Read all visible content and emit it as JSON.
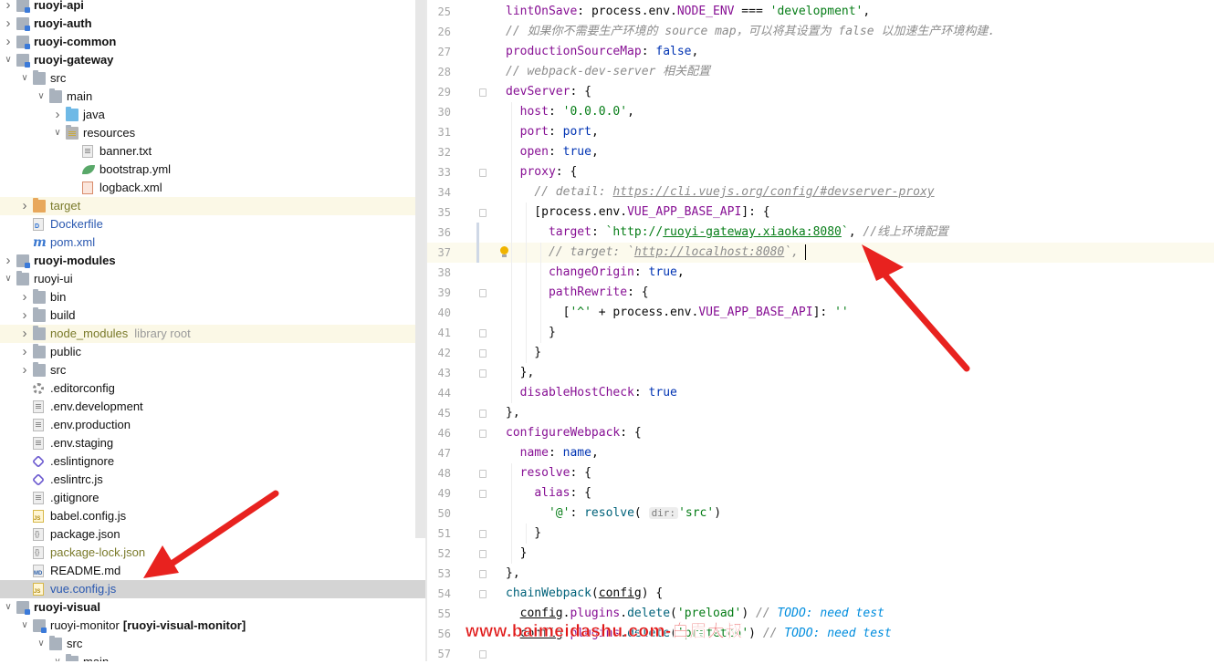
{
  "tree": [
    {
      "label": "ruoyi-api",
      "depth": 0,
      "icon": "module-folder-icon",
      "chev": "right",
      "bold": true
    },
    {
      "label": "ruoyi-auth",
      "depth": 0,
      "icon": "module-folder-icon",
      "chev": "right",
      "bold": true
    },
    {
      "label": "ruoyi-common",
      "depth": 0,
      "icon": "module-folder-icon",
      "chev": "right",
      "bold": true
    },
    {
      "label": "ruoyi-gateway",
      "depth": 0,
      "icon": "module-folder-icon",
      "chev": "down",
      "bold": true
    },
    {
      "label": "src",
      "depth": 1,
      "icon": "folder-icon",
      "chev": "down"
    },
    {
      "label": "main",
      "depth": 2,
      "icon": "folder-icon",
      "chev": "down"
    },
    {
      "label": "java",
      "depth": 3,
      "icon": "source-folder-icon",
      "chev": "right"
    },
    {
      "label": "resources",
      "depth": 3,
      "icon": "resources-folder-icon",
      "chev": "down"
    },
    {
      "label": "banner.txt",
      "depth": 4,
      "icon": "text-file-icon"
    },
    {
      "label": "bootstrap.yml",
      "depth": 4,
      "icon": "yaml-leaf-icon"
    },
    {
      "label": "logback.xml",
      "depth": 4,
      "icon": "xml-file-icon"
    },
    {
      "label": "target",
      "depth": 1,
      "icon": "excluded-folder-icon",
      "chev": "right",
      "style": "olive",
      "excluded": true
    },
    {
      "label": "Dockerfile",
      "depth": 1,
      "icon": "docker-file-icon",
      "style": "blue"
    },
    {
      "label": "pom.xml",
      "depth": 1,
      "icon": "maven-pom-icon",
      "style": "blue"
    },
    {
      "label": "ruoyi-modules",
      "depth": 0,
      "icon": "module-folder-icon",
      "chev": "right",
      "bold": true
    },
    {
      "label": "ruoyi-ui",
      "depth": 0,
      "icon": "folder-icon",
      "chev": "down"
    },
    {
      "label": "bin",
      "depth": 1,
      "icon": "folder-icon",
      "chev": "right"
    },
    {
      "label": "build",
      "depth": 1,
      "icon": "folder-icon",
      "chev": "right"
    },
    {
      "label": "node_modules",
      "depth": 1,
      "icon": "folder-icon",
      "chev": "right",
      "style": "olive",
      "hint": "library root",
      "excluded": true
    },
    {
      "label": "public",
      "depth": 1,
      "icon": "folder-icon",
      "chev": "right"
    },
    {
      "label": "src",
      "depth": 1,
      "icon": "folder-icon",
      "chev": "right"
    },
    {
      "label": ".editorconfig",
      "depth": 1,
      "icon": "gear-icon"
    },
    {
      "label": ".env.development",
      "depth": 1,
      "icon": "text-file-icon"
    },
    {
      "label": ".env.production",
      "depth": 1,
      "icon": "text-file-icon"
    },
    {
      "label": ".env.staging",
      "depth": 1,
      "icon": "text-file-icon"
    },
    {
      "label": ".eslintignore",
      "depth": 1,
      "icon": "eslint-icon"
    },
    {
      "label": ".eslintrc.js",
      "depth": 1,
      "icon": "eslint-icon"
    },
    {
      "label": ".gitignore",
      "depth": 1,
      "icon": "text-file-icon"
    },
    {
      "label": "babel.config.js",
      "depth": 1,
      "icon": "js-file-icon"
    },
    {
      "label": "package.json",
      "depth": 1,
      "icon": "json-file-icon"
    },
    {
      "label": "package-lock.json",
      "depth": 1,
      "icon": "json-file-icon",
      "style": "olive"
    },
    {
      "label": "README.md",
      "depth": 1,
      "icon": "markdown-file-icon"
    },
    {
      "label": "vue.config.js",
      "depth": 1,
      "icon": "js-file-icon",
      "style": "blue",
      "selected": true
    },
    {
      "label": "ruoyi-visual",
      "depth": 0,
      "icon": "module-folder-icon",
      "chev": "down",
      "bold": true
    },
    {
      "label": "ruoyi-monitor",
      "depth": 1,
      "icon": "module-folder-icon",
      "chev": "down",
      "hintBold": "[ruoyi-visual-monitor]"
    },
    {
      "label": "src",
      "depth": 2,
      "icon": "folder-icon",
      "chev": "down"
    },
    {
      "label": "main",
      "depth": 3,
      "icon": "folder-icon",
      "chev": "down"
    }
  ],
  "editor": {
    "first_line": 25,
    "current_line": 37,
    "lines": [
      [
        [
          "p",
          "lintOnSave"
        ],
        [
          "t",
          ": "
        ],
        [
          "t",
          "process.env."
        ],
        [
          "p",
          "NODE_ENV"
        ],
        [
          "t",
          " === "
        ],
        [
          "s",
          "'development'"
        ],
        [
          "t",
          ","
        ]
      ],
      [
        [
          "c",
          "// 如果你不需要生产环境的 source map，可以将其设置为 false 以加速生产环境构建."
        ]
      ],
      [
        [
          "p",
          "productionSourceMap"
        ],
        [
          "t",
          ": "
        ],
        [
          "b",
          "false"
        ],
        [
          "t",
          ","
        ]
      ],
      [
        [
          "c",
          "// webpack-dev-server 相关配置"
        ]
      ],
      [
        [
          "p",
          "devServer"
        ],
        [
          "t",
          ": {"
        ]
      ],
      [
        [
          "t",
          "  "
        ],
        [
          "p",
          "host"
        ],
        [
          "t",
          ": "
        ],
        [
          "s",
          "'0.0.0.0'"
        ],
        [
          "t",
          ","
        ]
      ],
      [
        [
          "t",
          "  "
        ],
        [
          "p",
          "port"
        ],
        [
          "t",
          ": "
        ],
        [
          "b",
          "port"
        ],
        [
          "t",
          ","
        ]
      ],
      [
        [
          "t",
          "  "
        ],
        [
          "p",
          "open"
        ],
        [
          "t",
          ": "
        ],
        [
          "b",
          "true"
        ],
        [
          "t",
          ","
        ]
      ],
      [
        [
          "t",
          "  "
        ],
        [
          "p",
          "proxy"
        ],
        [
          "t",
          ": {"
        ]
      ],
      [
        [
          "t",
          "    "
        ],
        [
          "c",
          "// detail: "
        ],
        [
          "u",
          "https://cli.vuejs.org/config/#devserver-proxy"
        ]
      ],
      [
        [
          "t",
          "    ["
        ],
        [
          "t",
          "process.env."
        ],
        [
          "p",
          "VUE_APP_BASE_API"
        ],
        [
          "t",
          "]: {"
        ]
      ],
      [
        [
          "t",
          "      "
        ],
        [
          "p",
          "target"
        ],
        [
          "t",
          ": "
        ],
        [
          "s",
          "`http://"
        ],
        [
          "us",
          "ruoyi-gateway.xiaoka:8080"
        ],
        [
          "s",
          "`"
        ],
        [
          "t",
          ", "
        ],
        [
          "c",
          "//线上环境配置"
        ]
      ],
      [
        [
          "t",
          "      "
        ],
        [
          "c",
          "// target: `"
        ],
        [
          "u",
          "http://localhost:8080"
        ],
        [
          "c",
          "`,"
        ]
      ],
      [
        [
          "t",
          "      "
        ],
        [
          "p",
          "changeOrigin"
        ],
        [
          "t",
          ": "
        ],
        [
          "b",
          "true"
        ],
        [
          "t",
          ","
        ]
      ],
      [
        [
          "t",
          "      "
        ],
        [
          "p",
          "pathRewrite"
        ],
        [
          "t",
          ": {"
        ]
      ],
      [
        [
          "t",
          "        ["
        ],
        [
          "s",
          "'^'"
        ],
        [
          "t",
          " + process.env."
        ],
        [
          "p",
          "VUE_APP_BASE_API"
        ],
        [
          "t",
          "]: "
        ],
        [
          "s",
          "''"
        ]
      ],
      [
        [
          "t",
          "      }"
        ]
      ],
      [
        [
          "t",
          "    }"
        ]
      ],
      [
        [
          "t",
          "  },"
        ]
      ],
      [
        [
          "t",
          "  "
        ],
        [
          "p",
          "disableHostCheck"
        ],
        [
          "t",
          ": "
        ],
        [
          "b",
          "true"
        ]
      ],
      [
        [
          "t",
          "},"
        ]
      ],
      [
        [
          "p",
          "configureWebpack"
        ],
        [
          "t",
          ": {"
        ]
      ],
      [
        [
          "t",
          "  "
        ],
        [
          "p",
          "name"
        ],
        [
          "t",
          ": "
        ],
        [
          "b",
          "name"
        ],
        [
          "t",
          ","
        ]
      ],
      [
        [
          "t",
          "  "
        ],
        [
          "p",
          "resolve"
        ],
        [
          "t",
          ": {"
        ]
      ],
      [
        [
          "t",
          "    "
        ],
        [
          "p",
          "alias"
        ],
        [
          "t",
          ": {"
        ]
      ],
      [
        [
          "t",
          "      "
        ],
        [
          "s",
          "'@'"
        ],
        [
          "t",
          ": "
        ],
        [
          "f",
          "resolve"
        ],
        [
          "t",
          "( "
        ],
        [
          "h",
          "dir:"
        ],
        [
          "s",
          "'src'"
        ],
        [
          "t",
          ")"
        ]
      ],
      [
        [
          "t",
          "    }"
        ]
      ],
      [
        [
          "t",
          "  }"
        ]
      ],
      [
        [
          "t",
          "},"
        ]
      ],
      [
        [
          "f",
          "chainWebpack"
        ],
        [
          "t",
          "("
        ],
        [
          "x",
          "config"
        ],
        [
          "t",
          ") {"
        ]
      ],
      [
        [
          "t",
          "  "
        ],
        [
          "x",
          "config"
        ],
        [
          "t",
          "."
        ],
        [
          "p",
          "plugins"
        ],
        [
          "t",
          "."
        ],
        [
          "f",
          "delete"
        ],
        [
          "t",
          "("
        ],
        [
          "s",
          "'preload'"
        ],
        [
          "t",
          ") "
        ],
        [
          "c",
          "// "
        ],
        [
          "todo",
          "TODO: need test"
        ]
      ],
      [
        [
          "t",
          "  "
        ],
        [
          "x",
          "config"
        ],
        [
          "t",
          "."
        ],
        [
          "p",
          "plugins"
        ],
        [
          "t",
          "."
        ],
        [
          "f",
          "delete"
        ],
        [
          "t",
          "("
        ],
        [
          "s",
          "'prefetch'"
        ],
        [
          "t",
          ") "
        ],
        [
          "c",
          "// "
        ],
        [
          "todo",
          "TODO: need test"
        ]
      ],
      [
        [
          "t",
          ""
        ]
      ]
    ]
  },
  "watermark": "www.baimeidashu.com-白眉大叔"
}
